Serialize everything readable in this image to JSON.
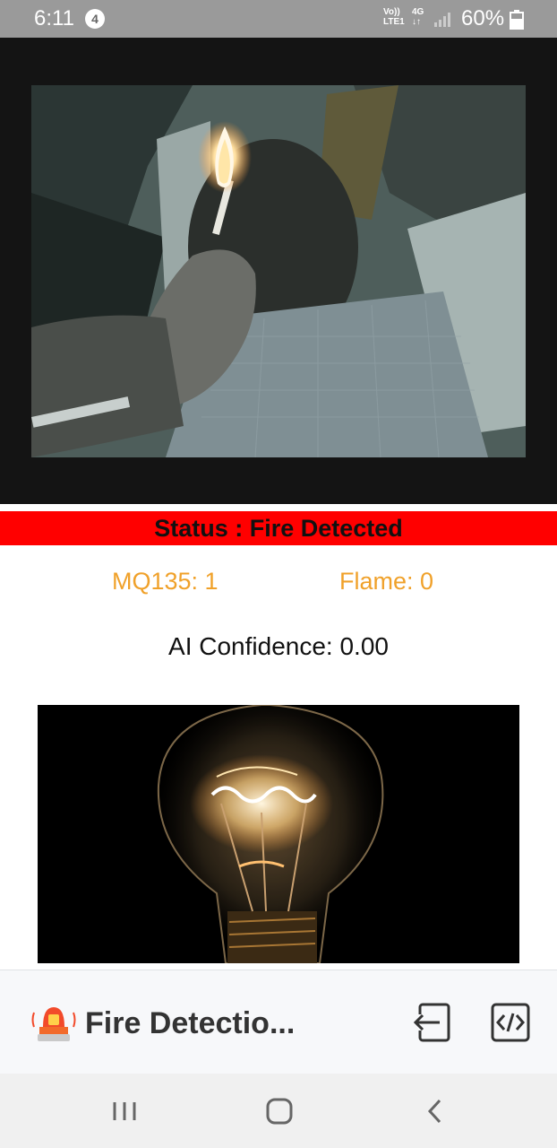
{
  "status_bar": {
    "time": "6:11",
    "notification_count": "4",
    "network_top": "Vo))",
    "network_bottom": "LTE1",
    "data_type": "4G",
    "battery": "60%"
  },
  "camera": {
    "icon": "camera-feed-image"
  },
  "status": {
    "text": "Status : Fire Detected",
    "color": "#ff0000"
  },
  "sensors": {
    "mq135": "MQ135: 1",
    "flame": "Flame: 0",
    "color": "#f0a12a"
  },
  "ai": {
    "confidence": "AI Confidence: 0.00"
  },
  "app_bar": {
    "title": "Fire Detectio...",
    "icon": "alarm-siren-icon",
    "exit_icon": "exit-icon",
    "code_icon": "code-icon"
  },
  "navigation": {
    "recent_icon": "recent-apps-icon",
    "home_icon": "home-icon",
    "back_icon": "back-icon"
  }
}
